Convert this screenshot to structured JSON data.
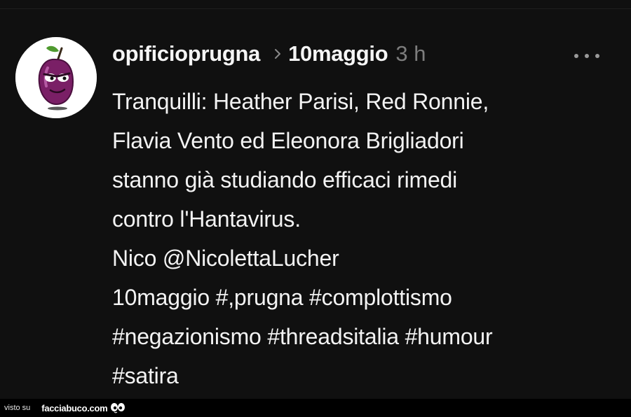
{
  "post": {
    "username": "opificioprugna",
    "topic": "10maggio",
    "time": "3 h",
    "body_lines": [
      "Tranquilli: Heather Parisi, Red Ronnie,",
      "Flavia Vento ed Eleonora Brigliadori",
      "stanno già studiando efficaci rimedi",
      "contro l'Hantavirus.",
      "Nico @NicolettaLucher",
      "10maggio #,prugna #complottismo",
      "#negazionismo #threadsitalia #humour",
      "#satira"
    ]
  },
  "icons": {
    "avatar": "plum-character-avatar",
    "separator": "chevron-right-icon",
    "menu": "more-options-icon",
    "watermark": "eyes-icon"
  },
  "watermark": {
    "prefix": "visto su",
    "site": "facciabuco.com"
  },
  "colors": {
    "background": "#101010",
    "text": "#f3f3f3",
    "muted": "#7d7d7d",
    "avatar_plum": "#7a1f66"
  }
}
